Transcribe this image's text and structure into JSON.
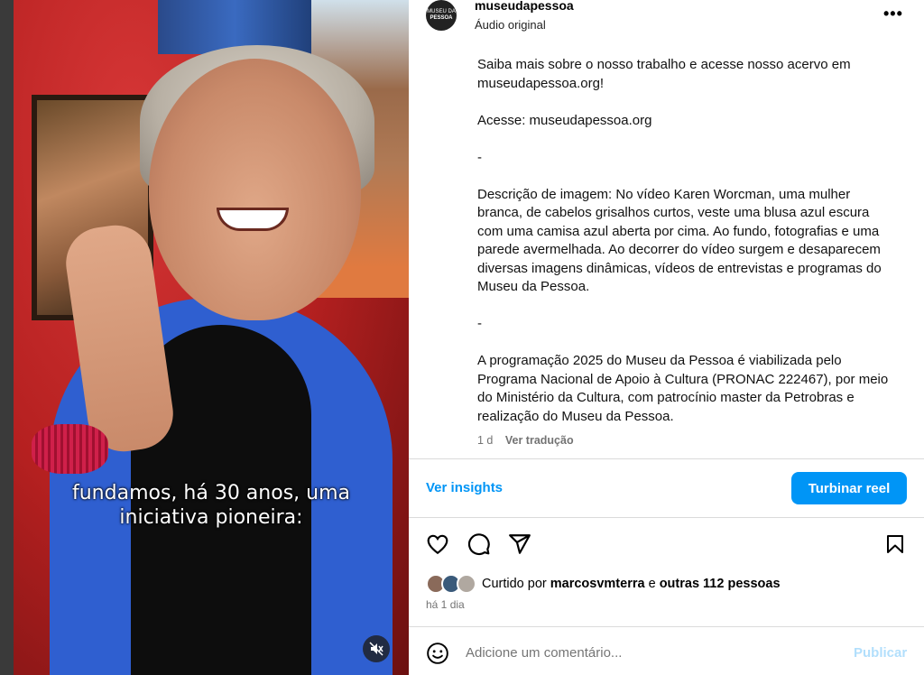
{
  "video": {
    "caption_line1": "fundamos, há 30 anos, uma",
    "caption_line2": "iniciativa pioneira:",
    "mute_icon": "speaker-muted-icon"
  },
  "header": {
    "avatar_line1": "MUSEU DA",
    "avatar_line2": "PESSOA",
    "username": "museudapessoa",
    "audio_label": "Áudio original",
    "more_icon": "•••"
  },
  "description": {
    "p1": "Saiba mais sobre o nosso trabalho e acesse nosso acervo em museudapessoa.org!",
    "p2": "Acesse: museudapessoa.org",
    "sep1": "-",
    "p3": "Descrição de imagem: No vídeo Karen Worcman, uma mulher branca, de cabelos grisalhos curtos, veste uma blusa azul escura com uma camisa azul aberta por cima. Ao fundo, fotografias e uma parede avermelhada. Ao decorrer do vídeo surgem e desaparecem diversas imagens dinâmicas, vídeos de entrevistas e programas do Museu da Pessoa.",
    "sep2": "-",
    "p4": "A programação 2025 do Museu da Pessoa é viabilizada pelo Programa Nacional de Apoio à Cultura (PRONAC 222467), por meio do Ministério da Cultura, com patrocínio master da Petrobras e realização do Museu da Pessoa.",
    "age": "1 d",
    "translate": "Ver tradução"
  },
  "promo": {
    "insights": "Ver insights",
    "boost": "Turbinar reel"
  },
  "likes": {
    "prefix": "Curtido por",
    "user": "marcosvmterra",
    "joiner": "e",
    "others": "outras 112 pessoas",
    "time": "há 1 dia"
  },
  "comment": {
    "placeholder": "Adicione um comentário...",
    "publish": "Publicar"
  },
  "colors": {
    "accent": "#0095f6",
    "publish_disabled": "#b2dffc"
  }
}
